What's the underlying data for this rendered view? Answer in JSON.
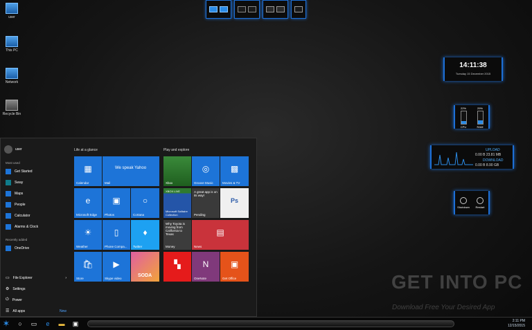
{
  "desktop": {
    "icons": [
      {
        "label": "user",
        "icon": "user-folder-icon"
      },
      {
        "label": "This PC",
        "icon": "computer-icon"
      },
      {
        "label": "Network",
        "icon": "network-icon"
      },
      {
        "label": "Recycle Bin",
        "icon": "recycle-bin-icon"
      }
    ]
  },
  "clock_widget": {
    "time": "14:11:38",
    "date": "Tuesday 15 December 2015"
  },
  "meters": {
    "cpu_value": "22%",
    "cpu_label": "CPU",
    "cpu_level": 0.22,
    "ram_value": "29%",
    "ram_label": "RAM",
    "ram_level": 0.29
  },
  "net": {
    "upload_label": "UPLOAD",
    "upload_value": "0.00 B  23.81 MB",
    "download_label": "DOWNLOAD",
    "download_value": "0.00 B   8.90 GB"
  },
  "power": {
    "shutdown": "Shutdown",
    "restart": "Restart"
  },
  "watermark": {
    "title": "GET INTO PC",
    "subtitle": "Download Free Your Desired App"
  },
  "start_menu": {
    "user": "user",
    "most_used_label": "Most used",
    "most_used": [
      "Get Started",
      "Sway",
      "Maps",
      "People",
      "Calculator",
      "Alarms & Clock"
    ],
    "recently_added_label": "Recently added",
    "recently_added": [
      "OneDrive"
    ],
    "bottom": [
      "File Explorer",
      "Settings",
      "Power",
      "All apps"
    ],
    "all_apps_new": "New",
    "group1": "Life at a glance",
    "group2": "Play and explore",
    "tiles": {
      "calendar": "Calendar",
      "mail_title": "We speak Yahoo",
      "mail": "Mail",
      "xbox": "Xbox",
      "groove": "Groove Music",
      "movies": "Movies & TV",
      "edge": "Microsoft Edge",
      "photos": "Photos",
      "cortana": "Cortana",
      "solitaire": "Microsoft Solitaire Collection",
      "xbox_live": "XBOX LIVE",
      "pending_text": "A great app is on its way!",
      "pending": "Pending",
      "weather": "Weather",
      "phone": "Phone Compa...",
      "twitter": "Twitter",
      "money_text": "Why Toyota is moving from California to Texas",
      "money": "Money",
      "news": "News",
      "store": "Store",
      "skype": "Skype video",
      "candy": "SODA",
      "onenote": "OneNote",
      "getoffice": "Get Office"
    }
  },
  "taskbar": {
    "time": "2:11 PM",
    "date": "12/15/2015"
  }
}
